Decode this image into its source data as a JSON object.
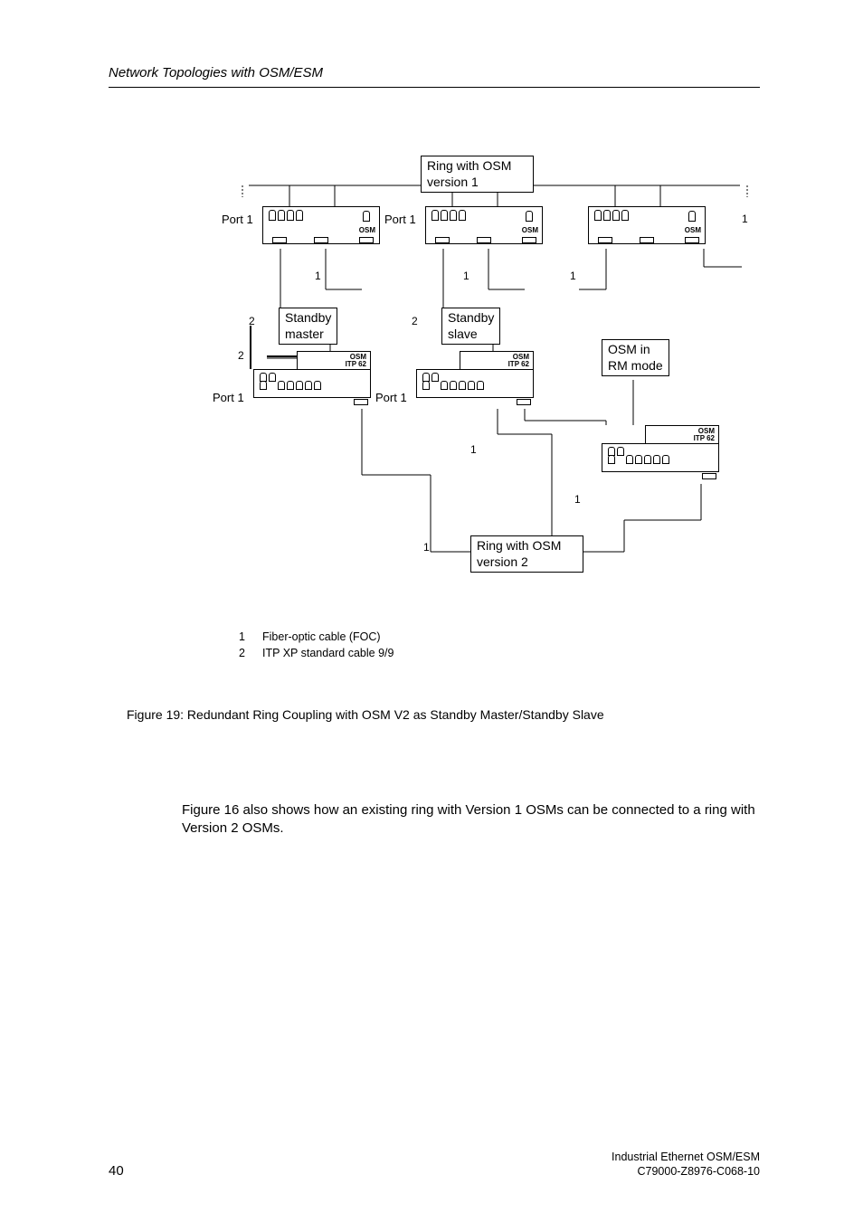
{
  "header": {
    "title": "Network Topologies with OSM/ESM"
  },
  "diagram": {
    "ring1_label": "Ring with OSM\nversion 1",
    "ring2_label": "Ring with OSM\nversion 2",
    "standby_master": "Standby\nmaster",
    "standby_slave": "Standby\nslave",
    "osm_rm_mode": "OSM in\nRM mode",
    "port1": "Port 1",
    "osm_text": "OSM",
    "osm_itp62": "OSM\nITP 62",
    "num1": "1",
    "num2": "2"
  },
  "legend": {
    "row1_num": "1",
    "row1_text": "Fiber-optic cable (FOC)",
    "row2_num": "2",
    "row2_text": "ITP XP standard cable 9/9"
  },
  "figure_caption": "Figure 19: Redundant Ring Coupling with OSM V2 as Standby Master/Standby Slave",
  "body": "Figure 16 also shows how an existing ring with Version 1 OSMs can be connected to a ring with Version 2 OSMs.",
  "footer": {
    "page": "40",
    "line1": "Industrial Ethernet OSM/ESM",
    "line2": "C79000-Z8976-C068-10"
  }
}
